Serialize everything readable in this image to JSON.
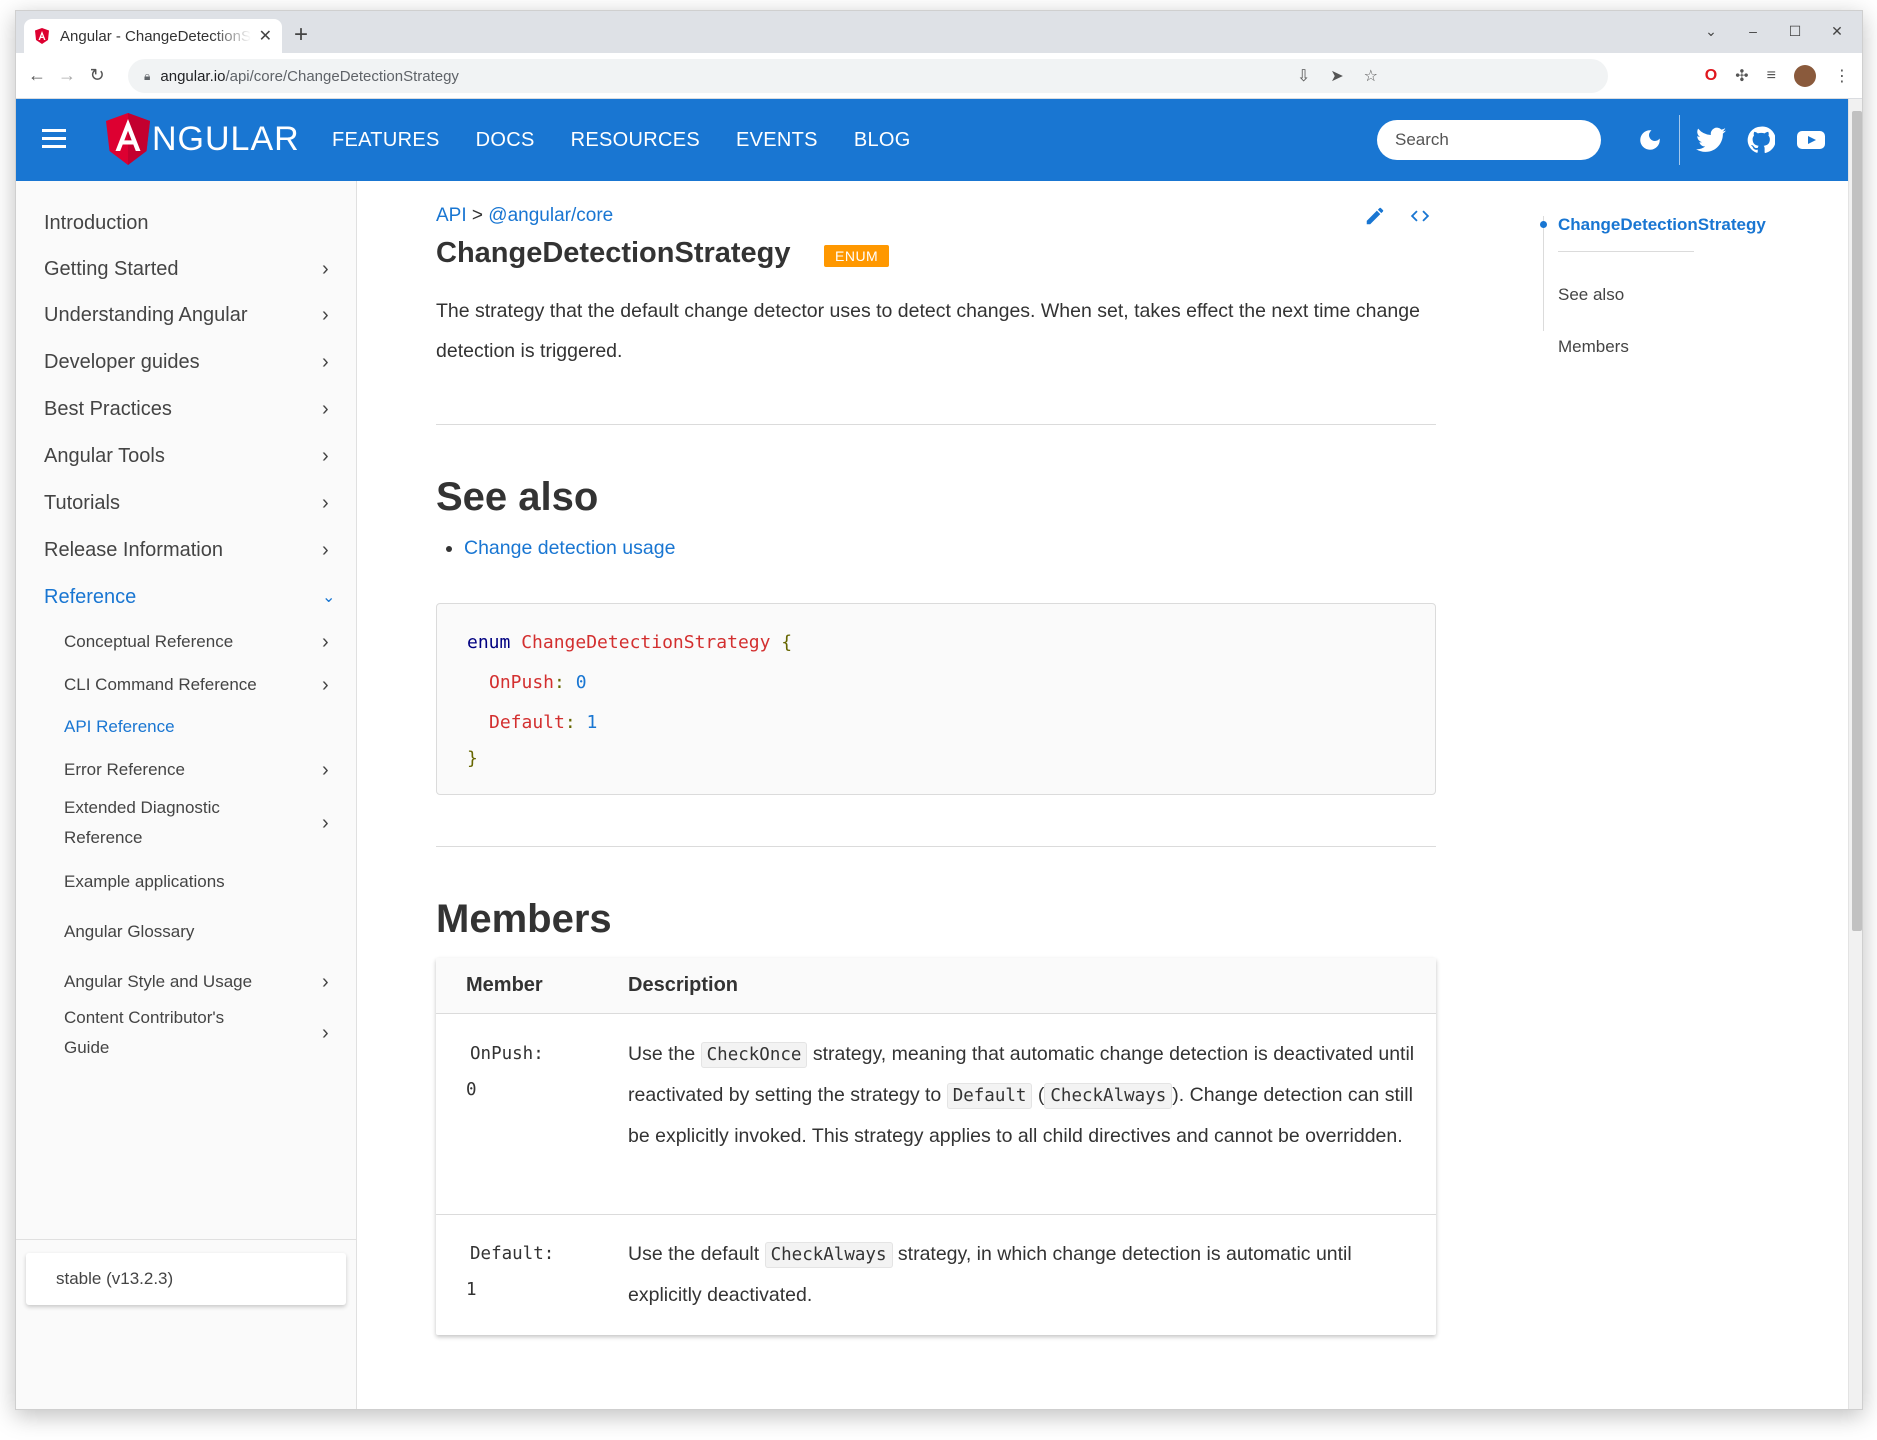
{
  "browser": {
    "tab_title": "Angular - ChangeDetectionStrategy",
    "url_host": "angular.io",
    "url_path": "/api/core/ChangeDetectionStrategy"
  },
  "header": {
    "logo_text": "NGULAR",
    "nav": [
      "FEATURES",
      "DOCS",
      "RESOURCES",
      "EVENTS",
      "BLOG"
    ],
    "search_placeholder": "Search"
  },
  "sidebar": {
    "items": [
      {
        "label": "Introduction"
      },
      {
        "label": "Getting Started"
      },
      {
        "label": "Understanding Angular"
      },
      {
        "label": "Developer guides"
      },
      {
        "label": "Best Practices"
      },
      {
        "label": "Angular Tools"
      },
      {
        "label": "Tutorials"
      },
      {
        "label": "Release Information"
      },
      {
        "label": "Reference"
      }
    ],
    "sub_items": [
      {
        "label": "Conceptual Reference"
      },
      {
        "label": "CLI Command Reference"
      },
      {
        "label": "API Reference"
      },
      {
        "label": "Error Reference"
      },
      {
        "label_line1": "Extended Diagnostic",
        "label_line2": "Reference"
      },
      {
        "label": "Example applications"
      },
      {
        "label": "Angular Glossary"
      },
      {
        "label": "Angular Style and Usage"
      },
      {
        "label_line1": "Content Contributor's",
        "label_line2": "Guide"
      }
    ],
    "version": "stable (v13.2.3)"
  },
  "main": {
    "breadcrumb_root": "API",
    "breadcrumb_sep": ">",
    "breadcrumb_pkg": "@angular/core",
    "title": "ChangeDetectionStrategy",
    "badge": "ENUM",
    "description": "The strategy that the default change detector uses to detect changes. When set, takes effect the next time change detection is triggered.",
    "see_also_heading": "See also",
    "see_also_link": "Change detection usage",
    "code": {
      "kw": "enum",
      "name": "ChangeDetectionStrategy",
      "open": "{",
      "m1": "OnPush",
      "v1": "0",
      "m2": "Default",
      "v2": "1",
      "close": "}"
    },
    "members_heading": "Members",
    "table": {
      "col_member": "Member",
      "col_description": "Description",
      "rows": [
        {
          "member": "OnPush:",
          "value": "0",
          "d1": "Use the ",
          "c1": "CheckOnce",
          "d2": " strategy, meaning that automatic change detection is deactivated until reactivated by setting the strategy to ",
          "c2": "Default",
          "d3": " (",
          "c3": "CheckAlways",
          "d4": "). Change detection can still be explicitly invoked. This strategy applies to all child directives and cannot be overridden."
        },
        {
          "member": "Default:",
          "value": "1",
          "d1": "Use the default ",
          "c1": "CheckAlways",
          "d2": " strategy, in which change detection is automatic until explicitly deactivated."
        }
      ]
    }
  },
  "toc": {
    "items": [
      "ChangeDetectionStrategy",
      "See also",
      "Members"
    ]
  },
  "colors": {
    "brand": "#1976d2",
    "badge": "#ff9800",
    "logo_red": "#dd0031"
  }
}
